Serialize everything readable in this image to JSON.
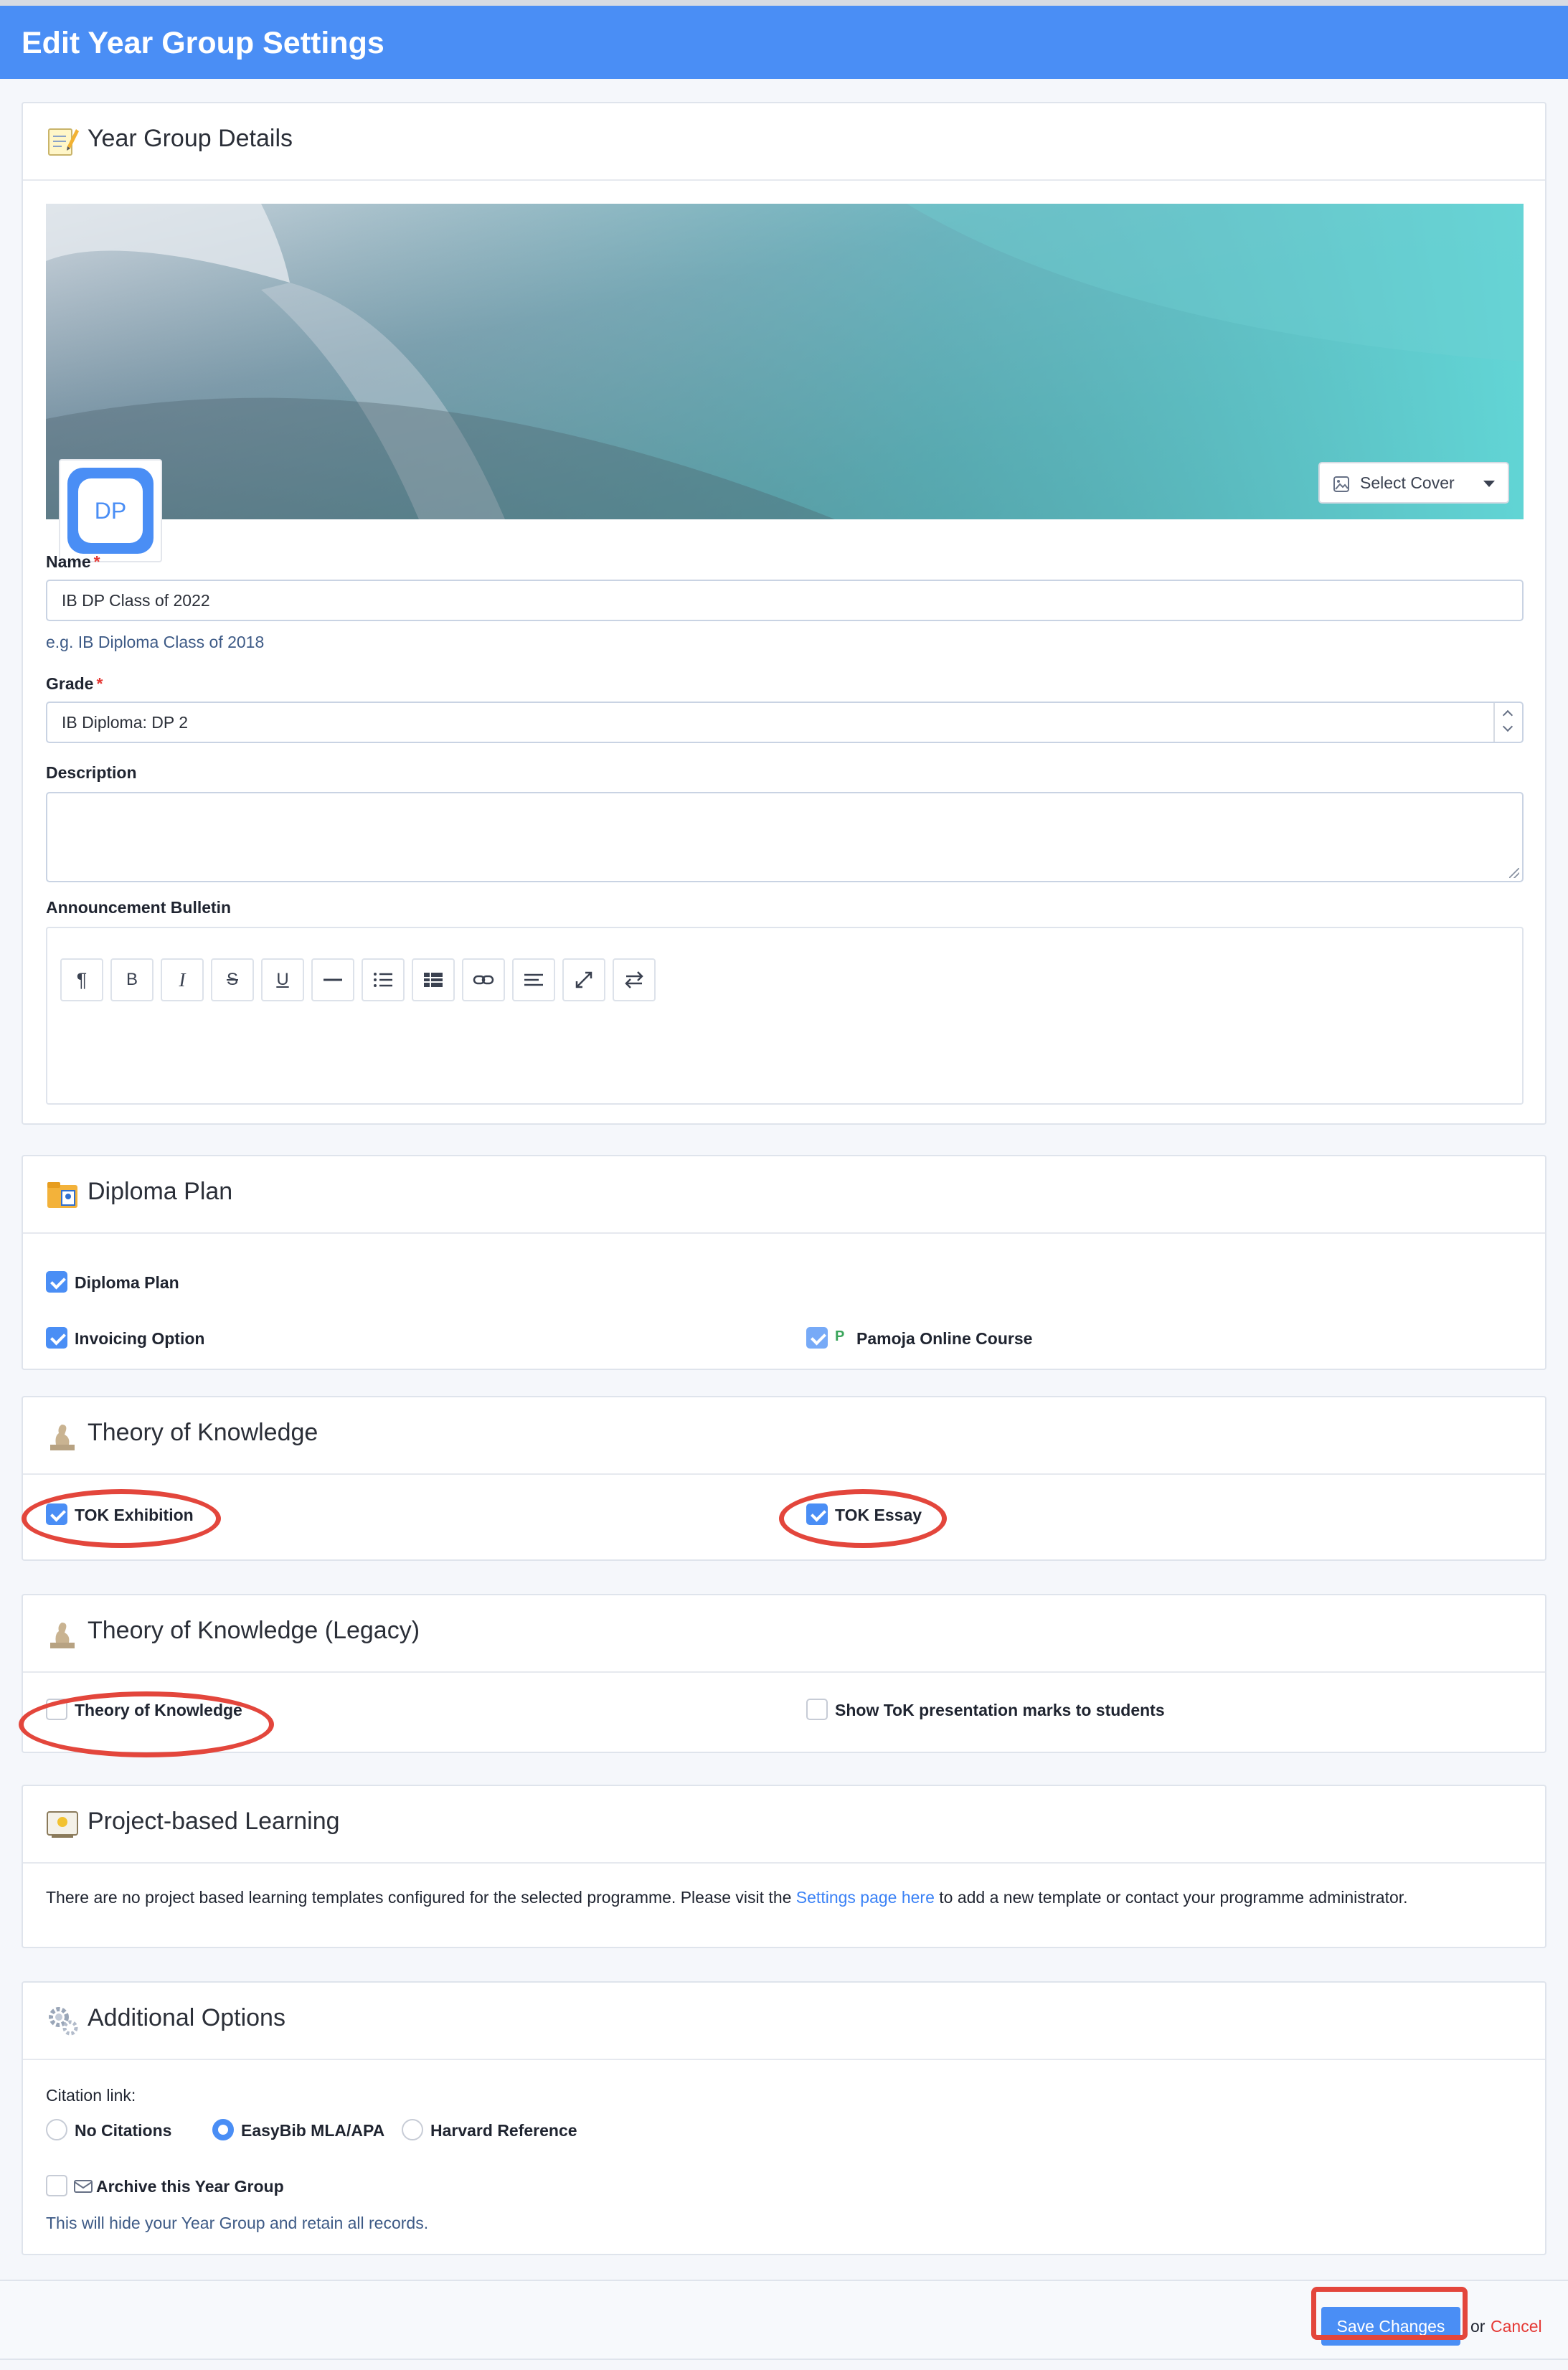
{
  "header": {
    "title": "Edit Year Group Settings"
  },
  "details": {
    "title": "Year Group Details",
    "select_cover": "Select Cover",
    "avatar_text": "DP",
    "name_label": "Name",
    "name_value": "IB DP Class of 2022",
    "name_hint": "e.g. IB Diploma Class of 2018",
    "grade_label": "Grade",
    "grade_value": "IB Diploma: DP 2",
    "description_label": "Description",
    "description_value": "",
    "bulletin_label": "Announcement Bulletin",
    "required_mark": "*"
  },
  "toolbar": {
    "paragraph": "¶",
    "bold": "B",
    "italic": "I",
    "strike": "S",
    "underline": "U"
  },
  "diploma": {
    "title": "Diploma Plan",
    "diploma_plan": "Diploma Plan",
    "invoicing": "Invoicing Option",
    "pamoja": "Pamoja Online Course",
    "pamoja_icon": "P",
    "diploma_plan_checked": true,
    "invoicing_checked": true,
    "pamoja_checked": true
  },
  "tok": {
    "title": "Theory of Knowledge",
    "exhibition": "TOK Exhibition",
    "essay": "TOK Essay",
    "exhibition_checked": true,
    "essay_checked": true
  },
  "tok_legacy": {
    "title": "Theory of Knowledge (Legacy)",
    "tok": "Theory of Knowledge",
    "show_marks": "Show ToK presentation marks to students",
    "tok_checked": false,
    "show_marks_checked": false
  },
  "pbl": {
    "title": "Project-based Learning",
    "text_before": "There are no project based learning templates configured for the selected programme. Please visit the",
    "link": "Settings page here",
    "text_after": "to add a new template or contact your programme administrator."
  },
  "additional": {
    "title": "Additional Options",
    "citation_label": "Citation link:",
    "no_citations": "No Citations",
    "easybib": "EasyBib MLA/APA",
    "harvard": "Harvard Reference",
    "selected_citation": "EasyBib MLA/APA",
    "archive": "Archive this Year Group",
    "archive_checked": false,
    "archive_hint": "This will hide your Year Group and retain all records."
  },
  "footer": {
    "save": "Save Changes",
    "or": "or",
    "cancel": "Cancel"
  },
  "colors": {
    "accent": "#4a8ef5",
    "highlight_ring": "#e3463c",
    "cancel": "#e53935"
  }
}
